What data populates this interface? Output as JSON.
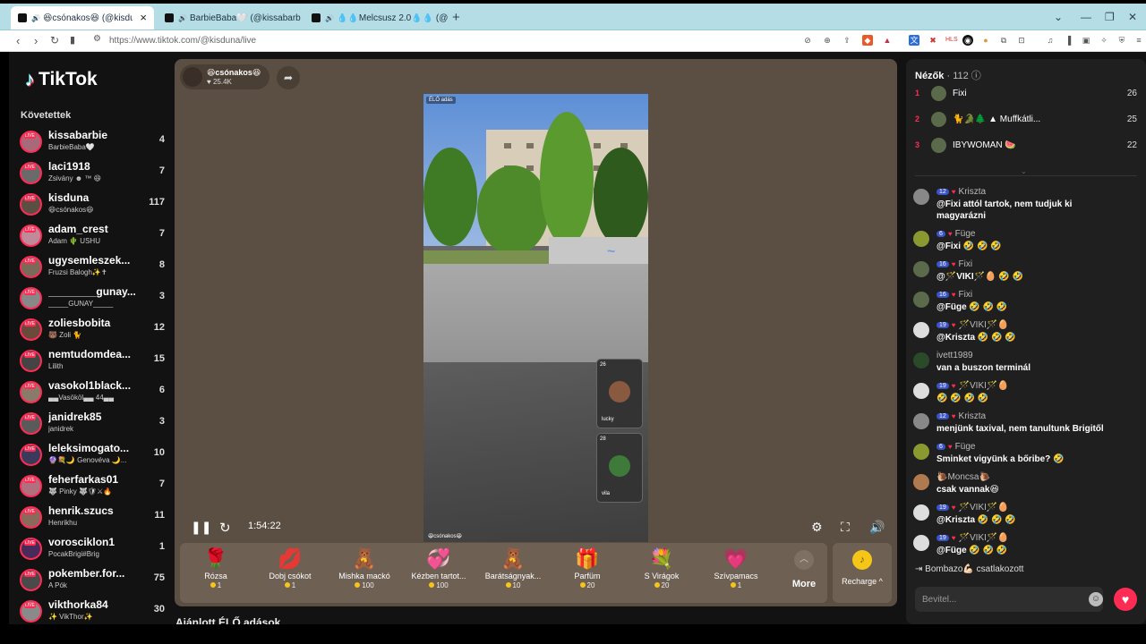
{
  "browser": {
    "tabs": [
      {
        "title": "😆csónakos😆 (@kisduna) é",
        "active": true
      },
      {
        "title": "BarbieBaba🤍 (@kissabarbie) ÉLŐ",
        "active": false
      },
      {
        "title": "💧💧Melcsusz 2.0💧💧 (@melcsu",
        "active": false
      }
    ],
    "new_tab": "+",
    "url": "https://www.tiktok.com/@kisduna/live"
  },
  "sidebar": {
    "logo": "TikTok",
    "following_label": "Követettek",
    "accounts": [
      {
        "name": "kissabarbie",
        "sub": "BarbieBaba🤍",
        "count": "4"
      },
      {
        "name": "laci1918",
        "sub": "Zsivány ☻ ™ 😆",
        "count": "7"
      },
      {
        "name": "kisduna",
        "sub": "😆csónakos😆",
        "count": "117"
      },
      {
        "name": "adam_crest",
        "sub": "Adam 🌵 USHU",
        "count": "7"
      },
      {
        "name": "ugysemleszek...",
        "sub": "Fruzsi Balogh✨✝",
        "count": "8"
      },
      {
        "name": "________gunay...",
        "sub": "_____GUNAY_____",
        "count": "3"
      },
      {
        "name": "zoliesbobita",
        "sub": "🐻 Zoli 🐈",
        "count": "12"
      },
      {
        "name": "nemtudomdea...",
        "sub": "Lilith",
        "count": "15"
      },
      {
        "name": "vasokol1black...",
        "sub": "▄▄Vasököl▄▄ 44▄▄",
        "count": "6"
      },
      {
        "name": "janidrek85",
        "sub": "janidrek",
        "count": "3"
      },
      {
        "name": "leleksimogato...",
        "sub": "🔮💐🌙 Genovéva 🌙...",
        "count": "10"
      },
      {
        "name": "feherfarkas01",
        "sub": "🐺 Pinky 🐺🛡⚔🔥",
        "count": "7"
      },
      {
        "name": "henrik.szucs",
        "sub": "Henrikhu",
        "count": "11"
      },
      {
        "name": "vorosciklon1",
        "sub": "PocakBrigi#Brig",
        "count": "1"
      },
      {
        "name": "pokember.for...",
        "sub": "A Pók",
        "count": "75"
      },
      {
        "name": "vikthorka84",
        "sub": "✨ VikThor✨",
        "count": "30"
      }
    ]
  },
  "stream": {
    "host_name": "😆csónakos😆",
    "host_likes": "♥ 25.4K",
    "share_icon": "➦",
    "video_tag": "ÉLŐ adás",
    "video_bottom": "😆csónakos😆",
    "guests": [
      {
        "count": "26",
        "name": "lucky"
      },
      {
        "count": "28",
        "name": "vila"
      }
    ],
    "timer": "1:54:22",
    "recommended": "Ajánlott ÉLŐ adások"
  },
  "gifts": [
    {
      "icon": "🌹",
      "name": "Rózsa",
      "price": "1"
    },
    {
      "icon": "💋",
      "name": "Dobj csókot",
      "price": "1"
    },
    {
      "icon": "🧸",
      "name": "Mishka mackó",
      "price": "100"
    },
    {
      "icon": "💞",
      "name": "Kézben tartot...",
      "price": "100"
    },
    {
      "icon": "🧸",
      "name": "Barátságnyak...",
      "price": "10"
    },
    {
      "icon": "🎁",
      "name": "Parfüm",
      "price": "20"
    },
    {
      "icon": "💐",
      "name": "S Virágok",
      "price": "20"
    },
    {
      "icon": "💗",
      "name": "Szívpamacs",
      "price": "1"
    }
  ],
  "more_label": "More",
  "recharge_label": "Recharge ^",
  "viewers": {
    "label": "Nézők",
    "count": "· 112",
    "top": [
      {
        "rank": "1",
        "name": "Fixi",
        "score": "26"
      },
      {
        "rank": "2",
        "name": "🐈🐊🌲 ▲ Muffkátli...",
        "score": "25"
      },
      {
        "rank": "3",
        "name": "IBYWOMAN 🍉",
        "score": "22"
      }
    ]
  },
  "chat": [
    {
      "badge": "12",
      "name": "Kriszta",
      "text": "@Fixi attól tartok, nem tudjuk ki magyarázni",
      "color": "#888"
    },
    {
      "badge": "6",
      "name": "Füge",
      "text": "@Fixi 🤣 🤣 🤣",
      "color": "#8a9a30"
    },
    {
      "badge": "16",
      "name": "Fixi",
      "text": "@🪄VIKI🪄🥚 🤣 🤣",
      "color": "#5a6a4a"
    },
    {
      "badge": "16",
      "name": "Fixi",
      "text": "@Füge 🤣 🤣 🤣",
      "color": "#5a6a4a"
    },
    {
      "badge": "19",
      "name": "🪄VIKI🪄🥚",
      "text": "@Kriszta 🤣 🤣 🤣",
      "color": "#ddd"
    },
    {
      "badge": "",
      "name": "ivett1989",
      "text": "van a buszon terminál",
      "color": "#2a4a2a"
    },
    {
      "badge": "19",
      "name": "🪄VIKI🪄🥚",
      "text": "🤣 🤣 🤣 🤣",
      "color": "#ddd"
    },
    {
      "badge": "12",
      "name": "Kriszta",
      "text": "menjünk taxival, nem tanultunk Brigitől",
      "color": "#888"
    },
    {
      "badge": "6",
      "name": "Füge",
      "text": "Sminket vigyünk a bőribe? 🤣",
      "color": "#8a9a30"
    },
    {
      "badge": "",
      "name": "🐌Moncsa🐌",
      "text": "csak vannak😆",
      "color": "#b07a50"
    },
    {
      "badge": "19",
      "name": "🪄VIKI🪄🥚",
      "text": "@Kriszta 🤣 🤣 🤣",
      "color": "#ddd"
    },
    {
      "badge": "19",
      "name": "🪄VIKI🪄🥚",
      "text": "@Füge 🤣 🤣 🤣",
      "color": "#ddd"
    }
  ],
  "join_text": "Bombazo💪🏻 csatlakozott",
  "input_placeholder": "Bevitel...",
  "accent": "#fe2c55"
}
